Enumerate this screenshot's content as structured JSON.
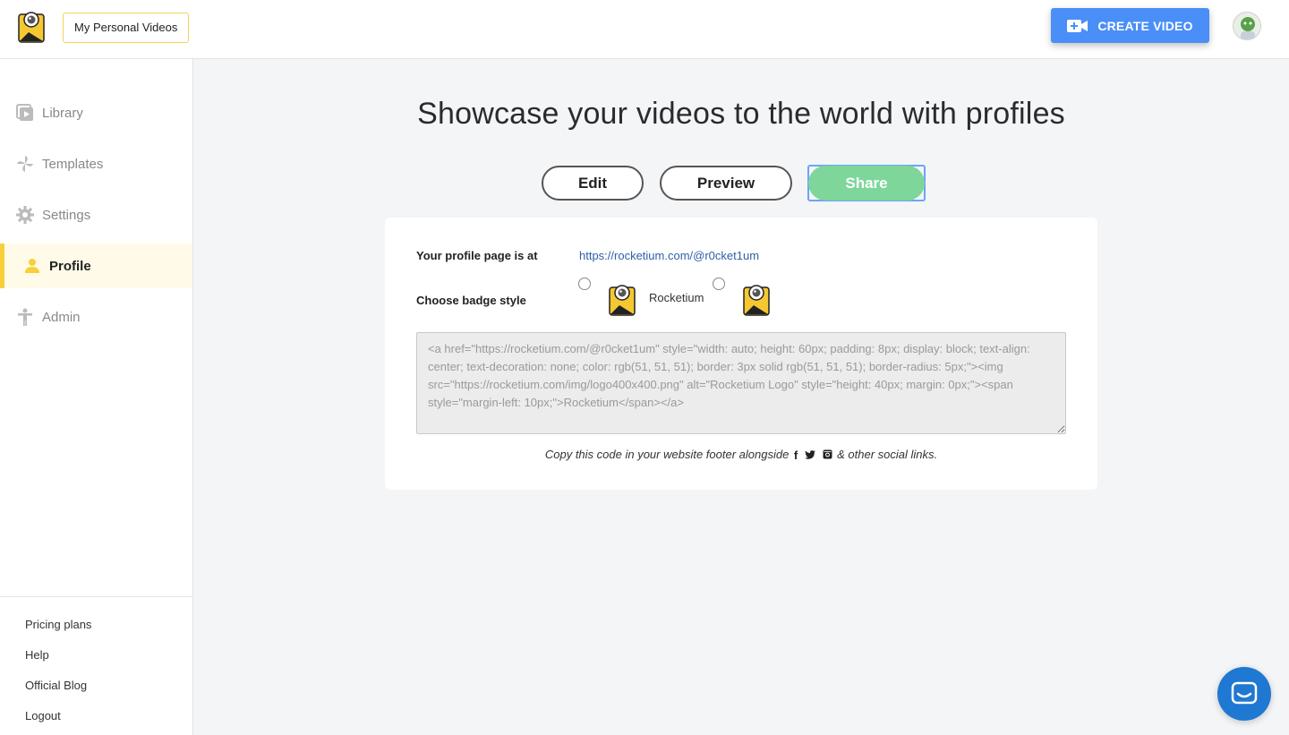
{
  "header": {
    "workspace_label": "My Personal Videos",
    "create_label": "CREATE VIDEO",
    "logo_icon": "rocketium-logo-icon",
    "avatar_icon": "user-avatar-icon"
  },
  "sidebar": {
    "items": [
      {
        "label": "Library",
        "icon": "library-icon",
        "active": false
      },
      {
        "label": "Templates",
        "icon": "pinwheel-icon",
        "active": false
      },
      {
        "label": "Settings",
        "icon": "gear-icon",
        "active": false
      },
      {
        "label": "Profile",
        "icon": "person-icon",
        "active": true
      },
      {
        "label": "Admin",
        "icon": "admin-figure-icon",
        "active": false
      }
    ],
    "footer_links": [
      "Pricing plans",
      "Help",
      "Official Blog",
      "Logout"
    ]
  },
  "main": {
    "title": "Showcase your videos to the world with profiles",
    "tabs": {
      "edit": "Edit",
      "preview": "Preview",
      "share": "Share"
    },
    "profile_label": "Your profile page is at",
    "profile_url": "https://rocketium.com/@r0cket1um",
    "badge_label": "Choose badge style",
    "badge_text": "Rocketium",
    "embed_code": "<a href=\"https://rocketium.com/@r0cket1um\" style=\"width: auto; height: 60px; padding: 8px; display: block; text-align: center; text-decoration: none; color: rgb(51, 51, 51); border: 3px solid rgb(51, 51, 51); border-radius: 5px;\"><img src=\"https://rocketium.com/img/logo400x400.png\" alt=\"Rocketium Logo\" style=\"height: 40px; margin: 0px;\"><span style=\"margin-left: 10px;\">Rocketium</span></a>",
    "hint_before": "Copy this code in your website footer alongside",
    "hint_after": "& other social links.",
    "social_icons": {
      "facebook": "f",
      "twitter": "❝",
      "instagram": "▣"
    }
  },
  "colors": {
    "accent_yellow": "#f7cf3a",
    "create_blue": "#4a8ff7",
    "share_green": "#7ed69b",
    "link_blue": "#2f5fa8",
    "chat_blue": "#1f78d1"
  }
}
